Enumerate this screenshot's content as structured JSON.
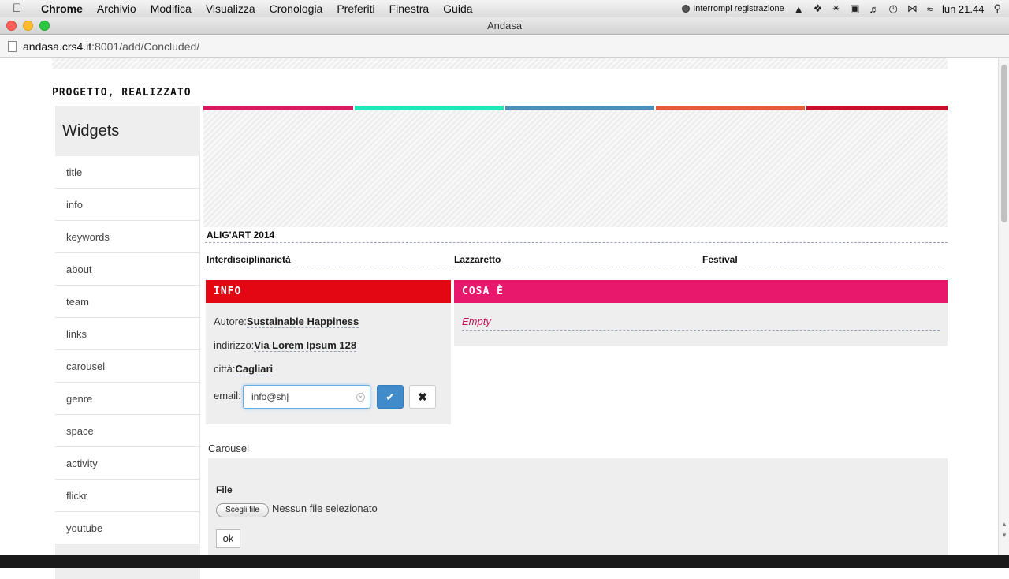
{
  "menubar": {
    "apple": "",
    "items": [
      "Chrome",
      "Archivio",
      "Modifica",
      "Visualizza",
      "Cronologia",
      "Preferiti",
      "Finestra",
      "Guida"
    ],
    "recording": "Interrompi registrazione",
    "clock": "lun 21.44"
  },
  "window": {
    "title": "Andasa"
  },
  "address": {
    "host": "andasa.crs4.it",
    "rest": ":8001/add/Concluded/"
  },
  "page": {
    "project_title": "PROGETTO, REALIZZATO",
    "sidebar": {
      "heading": "Widgets",
      "items": [
        "title",
        "info",
        "keywords",
        "about",
        "team",
        "links",
        "carousel",
        "genre",
        "space",
        "activity",
        "flickr",
        "youtube"
      ]
    },
    "color_bars": [
      "#d81b60",
      "#1de9b6",
      "#4a90b8",
      "#e65c3a",
      "#c8102e"
    ],
    "event_title": "ALIG'ART 2014",
    "keywords": [
      "Interdisciplinarietà",
      "Lazzaretto",
      "Festival"
    ],
    "info_panel": {
      "title": "INFO",
      "color": "#e30613",
      "fields": [
        {
          "label": "Autore:",
          "value": "Sustainable Happiness"
        },
        {
          "label": "indirizzo:",
          "value": "Via Lorem Ipsum 128"
        },
        {
          "label": "città:",
          "value": "Cagliari"
        }
      ],
      "email_label": "email:",
      "email_value": "info@sh|",
      "confirm_icon": "✔",
      "cancel_icon": "✖"
    },
    "cosa_panel": {
      "title": "COSA È",
      "color": "#e8186d",
      "empty_text": "Empty"
    },
    "carousel": {
      "label": "Carousel",
      "file_label": "File",
      "choose_button": "Scegli file",
      "file_status": "Nessun file selezionato",
      "ok_button": "ok"
    }
  }
}
